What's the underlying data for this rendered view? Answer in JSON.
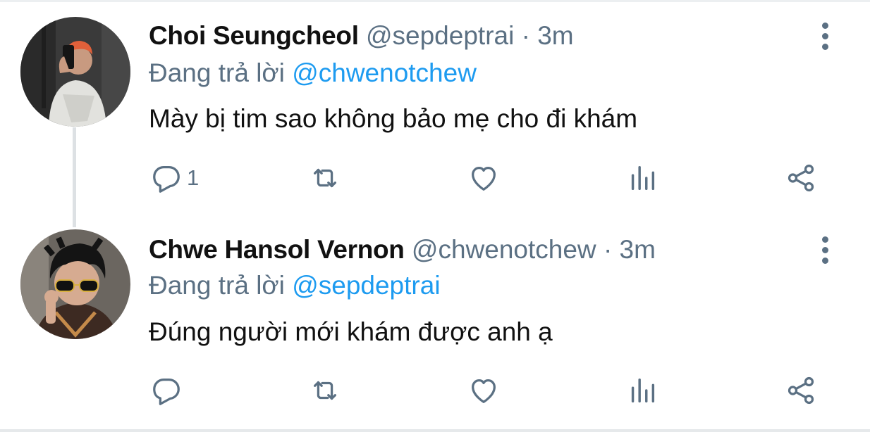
{
  "thread": [
    {
      "author_name": "Choi Seungcheol",
      "handle": "@sepdeptrai",
      "separator": "·",
      "time": "3m",
      "reply_prefix": "Đang trả lời",
      "reply_to": "@chwenotchew",
      "text": "Mày bị tim sao không bảo mẹ cho đi khám",
      "reply_count": "1",
      "avatar_icon": "profile-photo-man-with-phone"
    },
    {
      "author_name": "Chwe Hansol Vernon",
      "handle": "@chwenotchew",
      "separator": "·",
      "time": "3m",
      "reply_prefix": "Đang trả lời",
      "reply_to": "@sepdeptrai",
      "text": "Đúng người mới khám được anh ạ",
      "reply_count": "",
      "avatar_icon": "profile-photo-man-with-sunglasses"
    }
  ],
  "colors": {
    "secondary_text": "#5b7083",
    "mention": "#1d9bf0",
    "thread_line": "#dde1e4"
  }
}
